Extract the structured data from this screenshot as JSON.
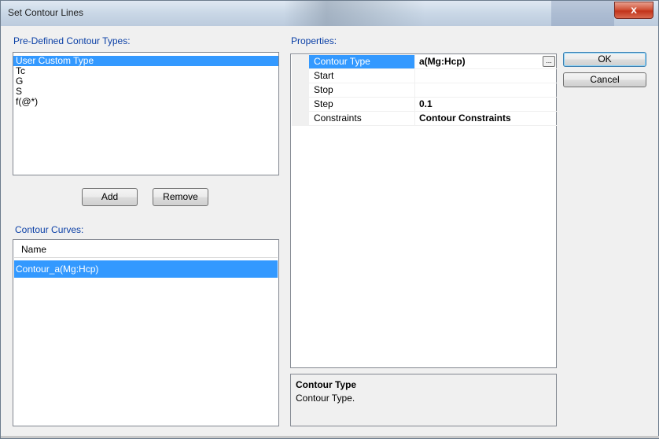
{
  "window": {
    "title": "Set Contour Lines",
    "close_label": "x"
  },
  "predefined": {
    "label": "Pre-Defined Contour Types:",
    "items": [
      {
        "label": "User Custom Type",
        "selected": true
      },
      {
        "label": "Tc",
        "selected": false
      },
      {
        "label": "G",
        "selected": false
      },
      {
        "label": "S",
        "selected": false
      },
      {
        "label": "f(@*)",
        "selected": false
      }
    ],
    "add_label": "Add",
    "remove_label": "Remove"
  },
  "curves": {
    "label": "Contour Curves:",
    "column_header": "Name",
    "rows": [
      "Contour_a(Mg:Hcp)"
    ]
  },
  "properties": {
    "label": "Properties:",
    "rows": [
      {
        "name": "Contour Type",
        "value": "a(Mg:Hcp)",
        "selected": true,
        "has_button": true,
        "button_label": "..."
      },
      {
        "name": "Start",
        "value": ""
      },
      {
        "name": "Stop",
        "value": ""
      },
      {
        "name": "Step",
        "value": "0.1"
      },
      {
        "name": "Constraints",
        "value": "Contour Constraints"
      }
    ],
    "help": {
      "title": "Contour Type",
      "description": "Contour Type."
    }
  },
  "buttons": {
    "ok": "OK",
    "cancel": "Cancel"
  },
  "colors": {
    "selection": "#3399ff",
    "group_label": "#0a3fa6"
  }
}
